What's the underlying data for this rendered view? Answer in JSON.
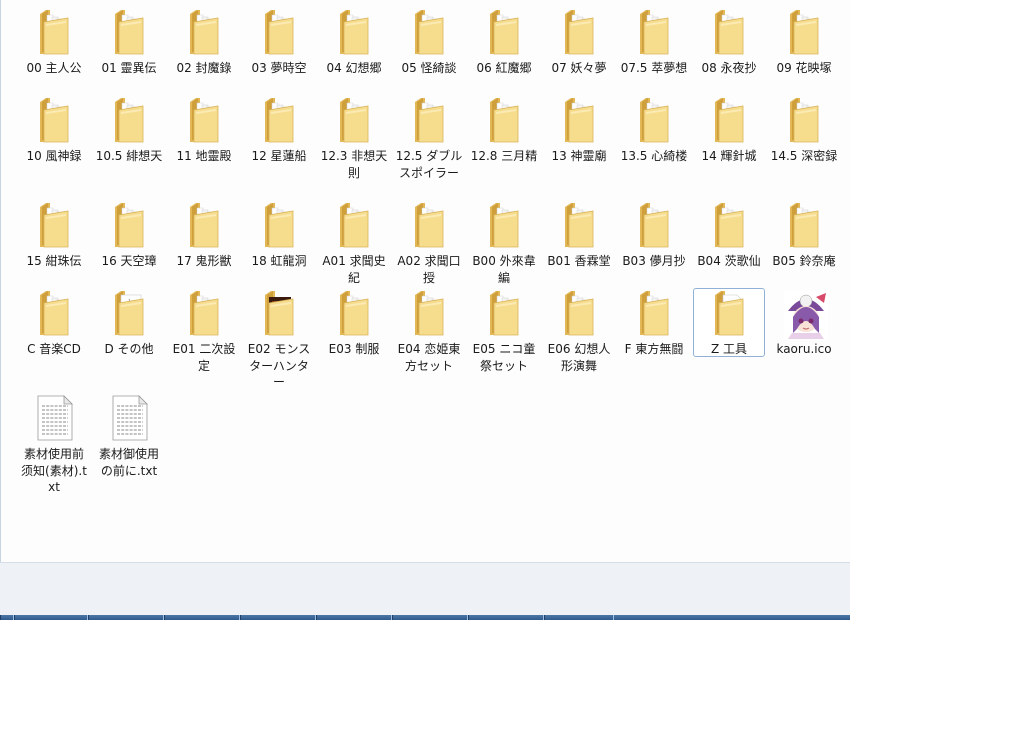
{
  "window": {
    "items": [
      {
        "label": "00 主人公",
        "type": "folder"
      },
      {
        "label": "01 靈異伝",
        "type": "folder"
      },
      {
        "label": "02 封魔錄",
        "type": "folder"
      },
      {
        "label": "03 夢時空",
        "type": "folder"
      },
      {
        "label": "04 幻想郷",
        "type": "folder"
      },
      {
        "label": "05 怪綺談",
        "type": "folder"
      },
      {
        "label": "06 紅魔郷",
        "type": "folder"
      },
      {
        "label": "07 妖々夢",
        "type": "folder"
      },
      {
        "label": "07.5 萃夢想",
        "type": "folder"
      },
      {
        "label": "08 永夜抄",
        "type": "folder"
      },
      {
        "label": "09 花映塚",
        "type": "folder"
      },
      {
        "label": "10 風神録",
        "type": "folder"
      },
      {
        "label": "10.5 緋想天",
        "type": "folder"
      },
      {
        "label": "11 地靈殿",
        "type": "folder"
      },
      {
        "label": "12 星蓮船",
        "type": "folder"
      },
      {
        "label": "12.3 非想天則",
        "type": "folder"
      },
      {
        "label": "12.5 ダブルスポイラー",
        "type": "folder"
      },
      {
        "label": "12.8 三月精",
        "type": "folder"
      },
      {
        "label": "13 神靈廟",
        "type": "folder"
      },
      {
        "label": "13.5 心綺楼",
        "type": "folder"
      },
      {
        "label": "14 輝針城",
        "type": "folder"
      },
      {
        "label": "14.5 深密録",
        "type": "folder"
      },
      {
        "label": "15 紺珠伝",
        "type": "folder"
      },
      {
        "label": "16 天空璋",
        "type": "folder"
      },
      {
        "label": "17 鬼形獣",
        "type": "folder"
      },
      {
        "label": "18 虹龍洞",
        "type": "folder"
      },
      {
        "label": "A01 求聞史紀",
        "type": "folder"
      },
      {
        "label": "A02 求聞口授",
        "type": "folder"
      },
      {
        "label": "B00 外來韋編",
        "type": "folder"
      },
      {
        "label": "B01 香霖堂",
        "type": "folder"
      },
      {
        "label": "B03 儚月抄",
        "type": "folder"
      },
      {
        "label": "B04 茨歌仙",
        "type": "folder"
      },
      {
        "label": "B05 鈴奈庵",
        "type": "folder"
      },
      {
        "label": "C 音楽CD",
        "type": "folder"
      },
      {
        "label": "D その他",
        "type": "folder-preview"
      },
      {
        "label": "E01 二次設定",
        "type": "folder"
      },
      {
        "label": "E02 モンスターハンター",
        "type": "folder-image"
      },
      {
        "label": "E03 制服",
        "type": "folder"
      },
      {
        "label": "E04 恋姫東方セット",
        "type": "folder"
      },
      {
        "label": "E05 ニコ童祭セット",
        "type": "folder"
      },
      {
        "label": "E06 幻想人形演舞",
        "type": "folder"
      },
      {
        "label": "F 東方無闘",
        "type": "folder"
      },
      {
        "label": "Z 工具",
        "type": "folder-empty",
        "selected": true
      },
      {
        "label": "kaoru.ico",
        "type": "ico"
      },
      {
        "label": "素材使用前须知(素材).txt",
        "type": "txt"
      },
      {
        "label": "素材御使用の前に.txt",
        "type": "txt"
      }
    ]
  },
  "icons": {
    "folder": "folder-icon",
    "folder-preview": "folder-icon",
    "folder-image": "folder-icon",
    "folder-empty": "folder-icon",
    "ico": "character-icon",
    "txt": "text-file-icon"
  },
  "colors": {
    "folder_back": "#e2b857",
    "folder_front": "#f6dd8e",
    "selection_border": "#8fb1d8",
    "taskbar": "#3e6a9c"
  }
}
